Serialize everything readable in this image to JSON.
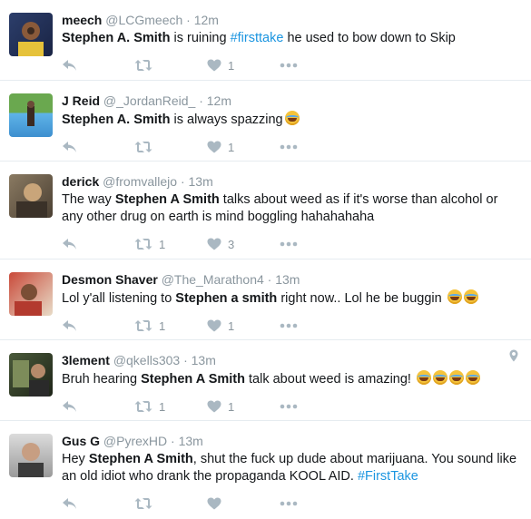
{
  "tweets": [
    {
      "name": "meech",
      "handle": "@LCGmeech",
      "time": "12m",
      "segments": [
        {
          "t": "Stephen A. Smith",
          "s": "bold"
        },
        {
          "t": " is ruining ",
          "s": "plain"
        },
        {
          "t": "#firsttake",
          "s": "tag"
        },
        {
          "t": " he used to bow down to Skip",
          "s": "plain"
        }
      ],
      "retweets": "",
      "likes": "1"
    },
    {
      "name": "J Reid",
      "handle": "@_JordanReid_",
      "time": "12m",
      "segments": [
        {
          "t": "Stephen A. Smith",
          "s": "bold"
        },
        {
          "t": " is always spazzing",
          "s": "plain"
        },
        {
          "t": "",
          "s": "emoji"
        }
      ],
      "retweets": "",
      "likes": "1"
    },
    {
      "name": "derick",
      "handle": "@fromvallejo",
      "time": "13m",
      "segments": [
        {
          "t": "The way ",
          "s": "plain"
        },
        {
          "t": "Stephen A Smith",
          "s": "bold"
        },
        {
          "t": " talks about weed as if it's worse than alcohol or any other drug on earth is mind boggling hahahahaha",
          "s": "plain"
        }
      ],
      "retweets": "1",
      "likes": "3"
    },
    {
      "name": "Desmon Shaver",
      "handle": "@The_Marathon4",
      "time": "13m",
      "segments": [
        {
          "t": "Lol y'all listening to ",
          "s": "plain"
        },
        {
          "t": "Stephen a smith",
          "s": "bold"
        },
        {
          "t": " right now.. Lol he be buggin ",
          "s": "plain"
        },
        {
          "t": "",
          "s": "emoji"
        },
        {
          "t": "",
          "s": "emoji"
        }
      ],
      "retweets": "1",
      "likes": "1"
    },
    {
      "name": "3lement",
      "handle": "@qkells303",
      "time": "13m",
      "segments": [
        {
          "t": "Bruh hearing ",
          "s": "plain"
        },
        {
          "t": "Stephen A Smith",
          "s": "bold"
        },
        {
          "t": " talk about weed is amazing! ",
          "s": "plain"
        },
        {
          "t": "",
          "s": "emoji"
        },
        {
          "t": "",
          "s": "emoji"
        },
        {
          "t": "",
          "s": "emoji"
        },
        {
          "t": "",
          "s": "emoji"
        }
      ],
      "retweets": "1",
      "likes": "1",
      "geo": true
    },
    {
      "name": "Gus G",
      "handle": "@PyrexHD",
      "time": "13m",
      "segments": [
        {
          "t": "Hey ",
          "s": "plain"
        },
        {
          "t": "Stephen A Smith",
          "s": "bold"
        },
        {
          "t": ", shut the fuck up dude about marijuana. You sound like an old idiot who drank the propaganda KOOL AID. ",
          "s": "plain"
        },
        {
          "t": "#FirstTake",
          "s": "tag"
        }
      ],
      "retweets": "",
      "likes": ""
    }
  ],
  "icons": {
    "reply": "reply-icon",
    "retweet": "retweet-icon",
    "like": "heart-icon",
    "more": "more-icon",
    "geo": "location-pin-icon"
  },
  "colors": {
    "accent": "#1b95e0",
    "icon": "#aab8c2",
    "meta": "#8a969e",
    "text": "#14171a"
  }
}
